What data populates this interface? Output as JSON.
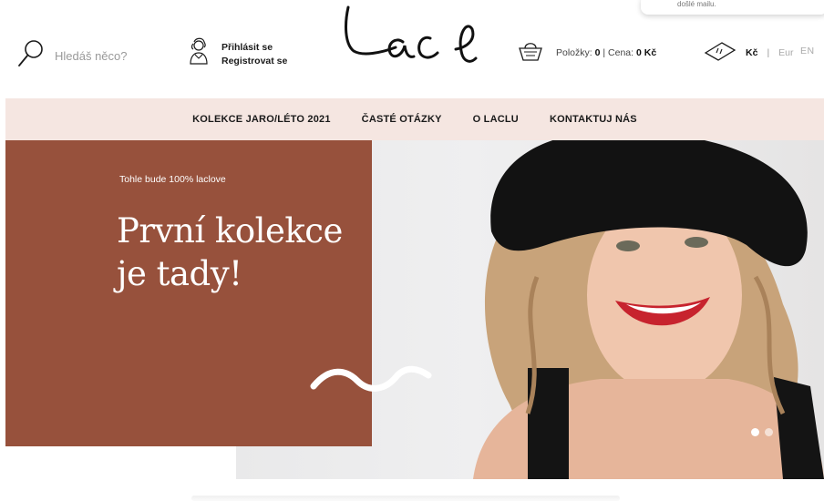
{
  "header": {
    "search_placeholder": "Hledáš něco?",
    "login_label": "Přihlásit se",
    "register_label": "Registrovat se",
    "logo_text": "lacl",
    "cart": {
      "items_label": "Položky:",
      "items_count": "0",
      "price_label": "Cena:",
      "price_value": "0 Kč"
    },
    "currency": {
      "czk": "Kč",
      "separator": "|",
      "eur": "Eur"
    },
    "language": "EN",
    "toast_text": "došlé mailu."
  },
  "nav": {
    "items": [
      {
        "label": "KOLEKCE JARO/LÉTO 2021"
      },
      {
        "label": "ČASTÉ OTÁZKY"
      },
      {
        "label": "O LACLU"
      },
      {
        "label": "KONTAKTUJ NÁS"
      }
    ]
  },
  "hero": {
    "eyebrow": "Tohle bude 100% laclove",
    "title_line1": "První kolekce",
    "title_line2": "je tady!",
    "slides_total": 2,
    "slide_active": 1
  },
  "colors": {
    "accent_panel": "#97513c",
    "nav_background": "#f5e6e1",
    "text_dark": "#1b1b1b"
  },
  "icons": [
    "search-icon",
    "user-avatar-icon",
    "basket-icon",
    "banknote-icon"
  ]
}
